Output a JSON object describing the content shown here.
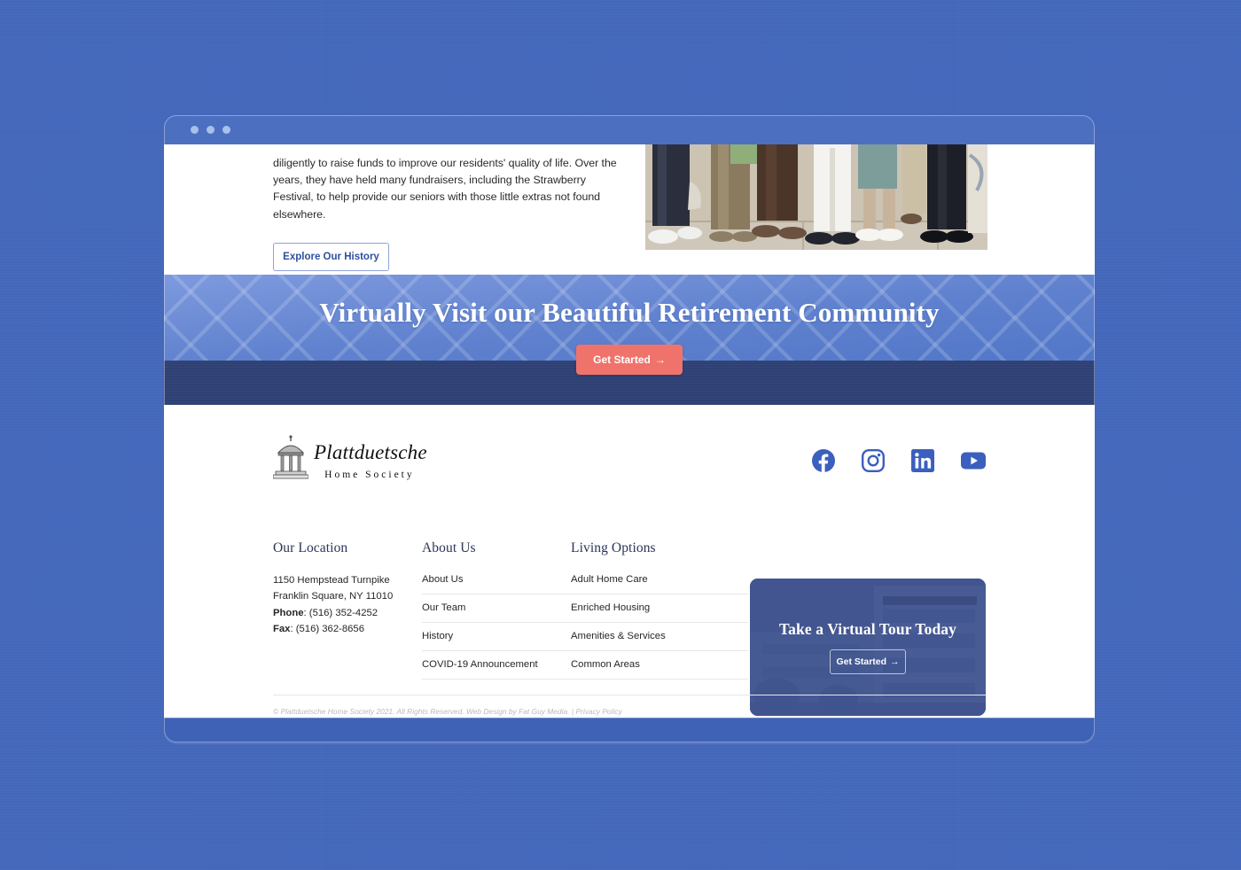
{
  "window": {
    "dots": [
      "dot-1",
      "dot-2",
      "dot-3"
    ]
  },
  "article": {
    "paragraph": "diligently to raise funds to improve our residents' quality of life. Over the years, they have held many fundraisers, including the Strawberry Festival, to help provide our seniors with those little extras not found elsewhere.",
    "cta_label": "Explore Our History",
    "photo_alt": "group-of-people-standing-photo"
  },
  "cta_banner": {
    "heading_bold": "Virtually Visit",
    "heading_rest": " our Beautiful Retirement Community",
    "button_label": "Get Started",
    "button_arrow": "→",
    "button_color": "#f0736b",
    "banner_color": "#5f81ce",
    "strip_color": "#2e4074"
  },
  "footer": {
    "logo": {
      "name": "Plattduetsche",
      "subtitle": "Home Society",
      "icon": "cupola-gazebo-icon"
    },
    "socials": [
      {
        "name": "facebook-icon",
        "label": "Facebook"
      },
      {
        "name": "instagram-icon",
        "label": "Instagram"
      },
      {
        "name": "linkedin-icon",
        "label": "LinkedIn"
      },
      {
        "name": "youtube-icon",
        "label": "YouTube"
      }
    ],
    "social_color": "#3b5fbe",
    "location": {
      "title": "Our Location",
      "street": "1150 Hempstead Turnpike",
      "city": "Franklin Square, NY 11010",
      "phone_label": "Phone",
      "phone": ": (516) 352-4252",
      "fax_label": "Fax",
      "fax": ": (516) 362-8656"
    },
    "about": {
      "title": "About Us",
      "links": [
        "About Us",
        "Our Team",
        "History",
        "COVID-19 Announcement"
      ]
    },
    "living": {
      "title": "Living Options",
      "links": [
        "Adult Home Care",
        "Enriched Housing",
        "Amenities & Services",
        "Common Areas"
      ]
    },
    "tour_card": {
      "title": "Take a Virtual Tour Today",
      "button_label": "Get Started",
      "button_arrow": "→",
      "photo_alt": "retirement-building-photo"
    },
    "copyright": "© Plattduetsche Home Society 2021. All Rights Reserved. Web Design by Fat Guy Media. | ",
    "privacy_label": "Privacy Policy"
  }
}
